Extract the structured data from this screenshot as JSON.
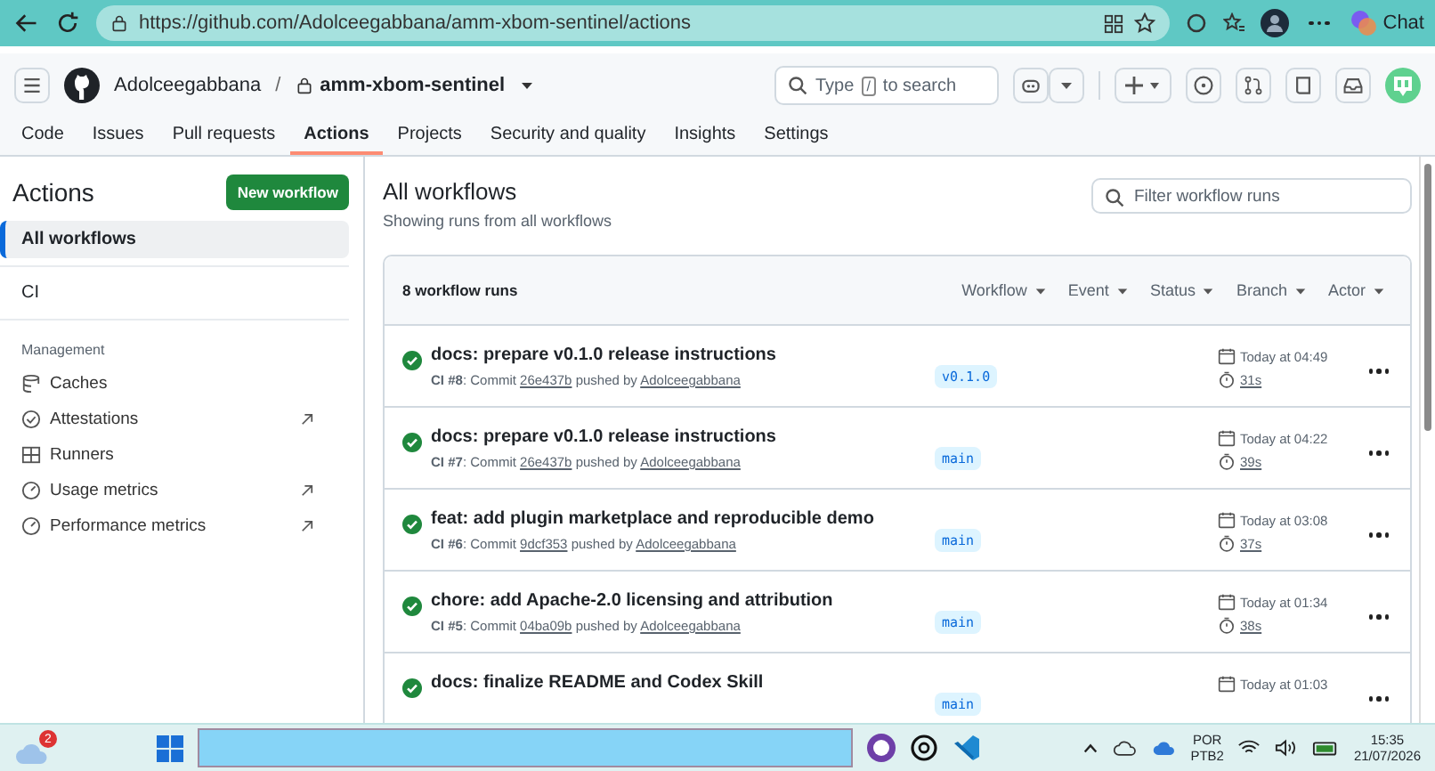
{
  "browser": {
    "url": "https://github.com/Adolceegabbana/amm-xbom-sentinel/actions",
    "chat": "Chat"
  },
  "header": {
    "owner": "Adolceegabbana",
    "separator": "/",
    "repo": "amm-xbom-sentinel",
    "search": {
      "before": "Type",
      "key": "/",
      "after": "to search"
    }
  },
  "nav": [
    {
      "label": "Code",
      "selected": false
    },
    {
      "label": "Issues",
      "selected": false
    },
    {
      "label": "Pull requests",
      "selected": false
    },
    {
      "label": "Actions",
      "selected": true
    },
    {
      "label": "Projects",
      "selected": false
    },
    {
      "label": "Security and quality",
      "selected": false
    },
    {
      "label": "Insights",
      "selected": false
    },
    {
      "label": "Settings",
      "selected": false
    }
  ],
  "sidebar": {
    "title": "Actions",
    "new_button": "New workflow",
    "workflows": [
      {
        "label": "All workflows",
        "selected": true
      },
      {
        "label": "CI",
        "selected": false
      }
    ],
    "section": "Management",
    "management": [
      {
        "label": "Caches",
        "kind": "caches",
        "external": false
      },
      {
        "label": "Attestations",
        "kind": "attest",
        "external": true
      },
      {
        "label": "Runners",
        "kind": "runners",
        "external": false
      },
      {
        "label": "Usage metrics",
        "kind": "metrics",
        "external": true
      },
      {
        "label": "Performance metrics",
        "kind": "metrics",
        "external": true
      }
    ]
  },
  "main": {
    "title": "All workflows",
    "subtitle": "Showing runs from all workflows",
    "filter_placeholder": "Filter workflow runs",
    "count": "8 workflow runs",
    "filters": [
      "Workflow",
      "Event",
      "Status",
      "Branch",
      "Actor"
    ],
    "runs": [
      {
        "title": "docs: prepare v0.1.0 release instructions",
        "meta": "**CI #8**: Commit",
        "commit": "26e437b",
        "pushed": "pushed by",
        "author": "Adolceegabbana",
        "branch": "v0.1.0",
        "time": "Today at 04:49",
        "duration": "31s"
      },
      {
        "title": "docs: prepare v0.1.0 release instructions",
        "meta": "**CI #7**: Commit",
        "commit": "26e437b",
        "pushed": "pushed by",
        "author": "Adolceegabbana",
        "branch": "main",
        "time": "Today at 04:22",
        "duration": "39s"
      },
      {
        "title": "feat: add plugin marketplace and reproducible demo",
        "meta": "**CI #6**: Commit",
        "commit": "9dcf353",
        "pushed": "pushed by",
        "author": "Adolceegabbana",
        "branch": "main",
        "time": "Today at 03:08",
        "duration": "37s"
      },
      {
        "title": "chore: add Apache-2.0 licensing and attribution",
        "meta": "**CI #5**: Commit",
        "commit": "04ba09b",
        "pushed": "pushed by",
        "author": "Adolceegabbana",
        "branch": "main",
        "time": "Today at 01:34",
        "duration": "38s"
      },
      {
        "title": "docs: finalize README and Codex Skill",
        "branch": "main",
        "time": "Today at 01:03"
      }
    ]
  },
  "taskbar": {
    "weather_badge": "2",
    "lang": "POR",
    "layout": "PTB2",
    "time": "15:35",
    "date": "21/07/2026"
  }
}
